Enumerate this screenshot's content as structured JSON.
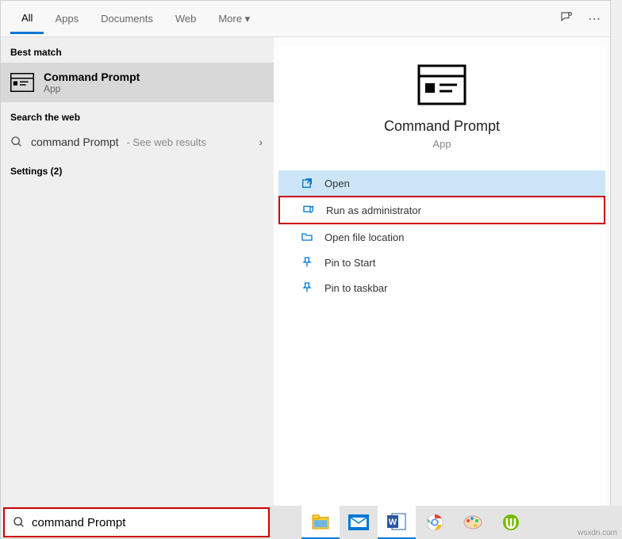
{
  "tabs": {
    "all": "All",
    "apps": "Apps",
    "documents": "Documents",
    "web": "Web",
    "more": "More ▾"
  },
  "sections": {
    "best": "Best match",
    "web": "Search the web",
    "settings": "Settings (2)"
  },
  "bestMatch": {
    "title": "Command Prompt",
    "sub": "App"
  },
  "webResult": {
    "query": "command Prompt",
    "hint": " - See web results"
  },
  "preview": {
    "title": "Command Prompt",
    "sub": "App"
  },
  "actions": {
    "open": "Open",
    "runAdmin": "Run as administrator",
    "openLoc": "Open file location",
    "pinStart": "Pin to Start",
    "pinTask": "Pin to taskbar"
  },
  "search": {
    "value": "command Prompt"
  },
  "watermark": "wsxdn.com"
}
